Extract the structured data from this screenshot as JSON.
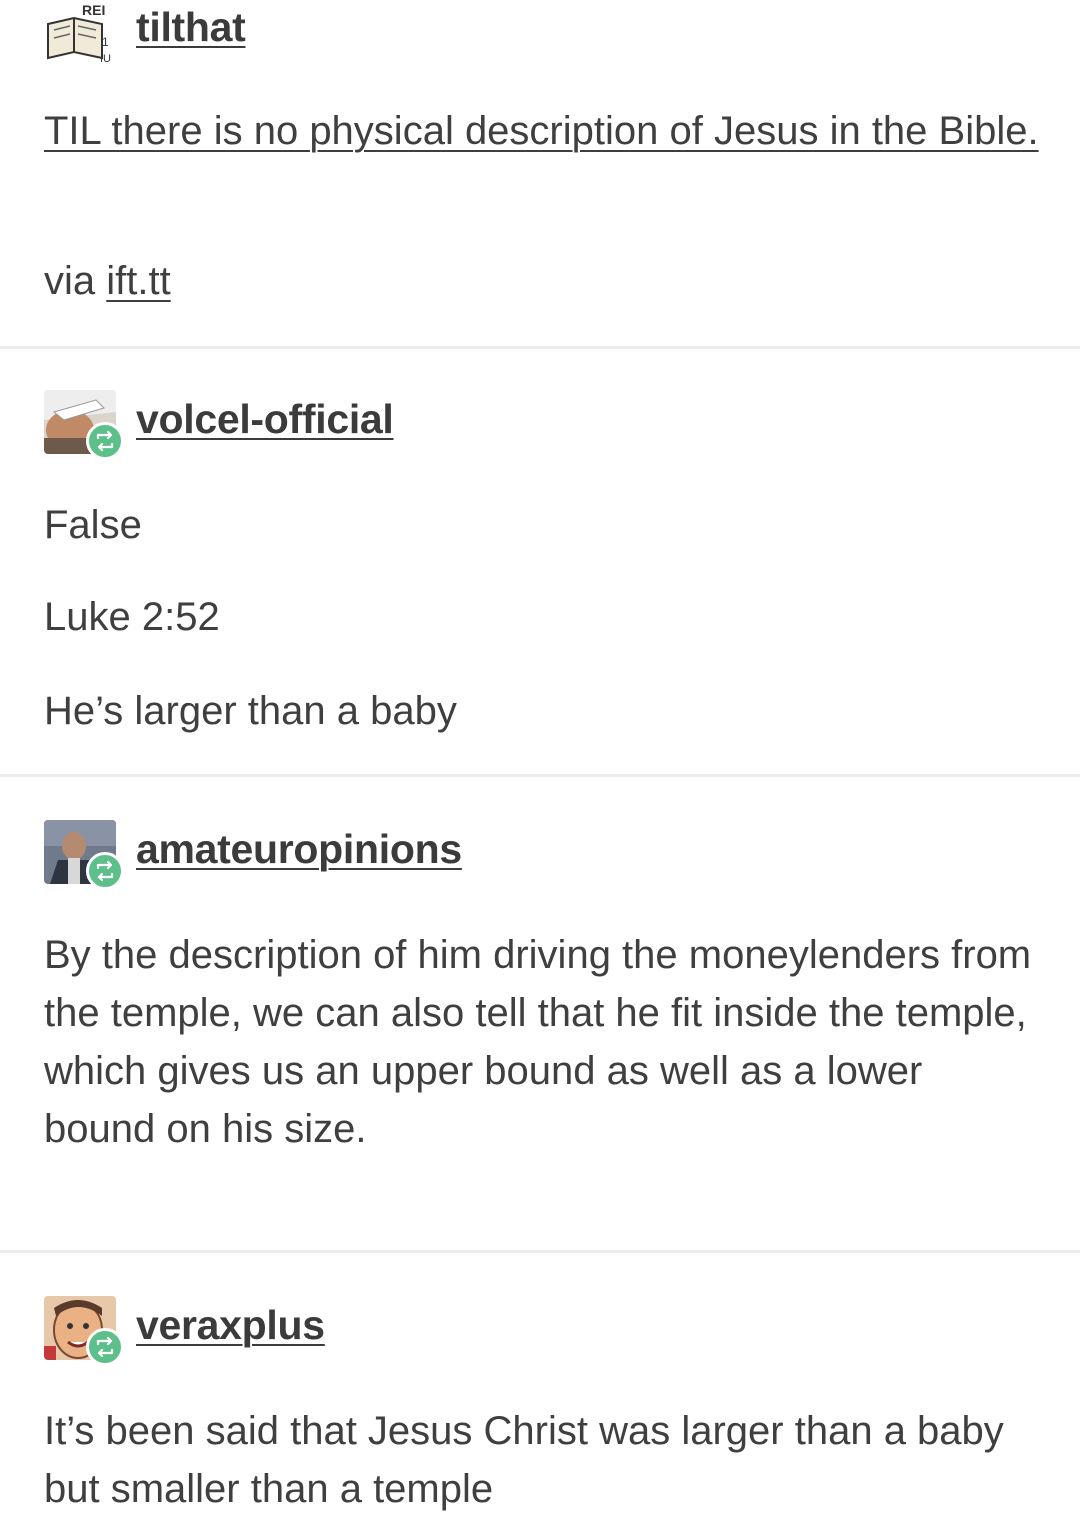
{
  "posts": [
    {
      "username": "tilthat",
      "avatar_icon": "book-avatar-icon",
      "title": "TIL there is no physical description of Jesus in the Bible.",
      "via_prefix": "via ",
      "via_link": "ift.tt"
    },
    {
      "username": "volcel-official",
      "avatar_icon": "reblog-icon",
      "lines": [
        "False",
        "Luke 2:52",
        "He’s larger than a baby"
      ]
    },
    {
      "username": "amateuropinions",
      "avatar_icon": "reblog-icon",
      "body": "By the description of him driving the moneylenders from the temple, we can also tell that he fit inside the temple, which gives us an upper bound as well as a lower bound on his size."
    },
    {
      "username": "veraxplus",
      "avatar_icon": "reblog-icon",
      "body": "It’s been said that Jesus Christ was larger than a baby but smaller than a temple"
    }
  ],
  "colors": {
    "reblog_badge": "#5dbf8a",
    "divider": "#ececec",
    "text": "#3f3f3f"
  }
}
